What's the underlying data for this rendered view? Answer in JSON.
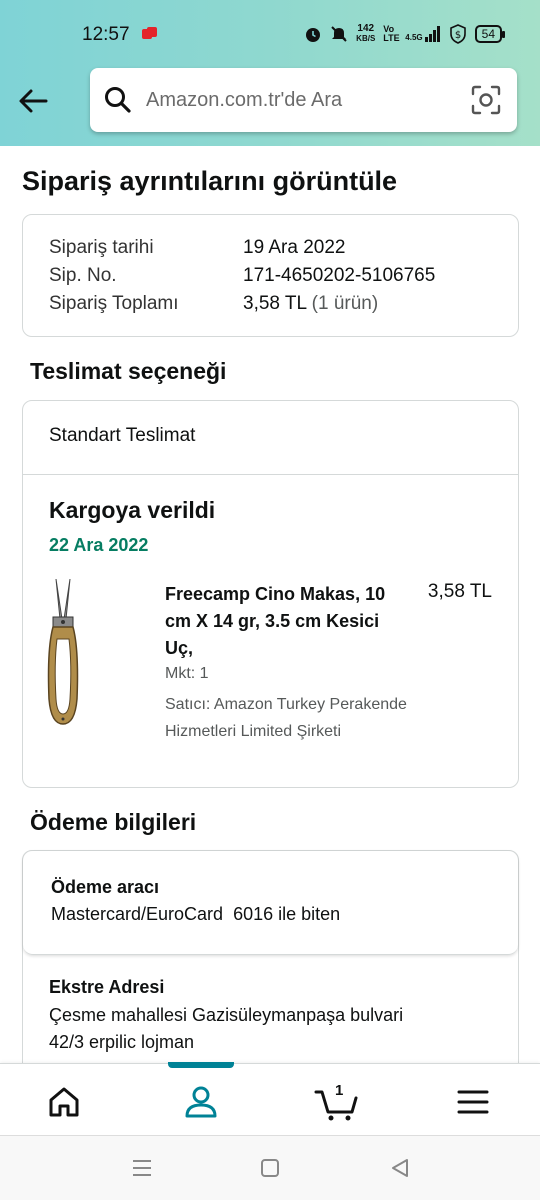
{
  "status_bar": {
    "time": "12:57",
    "net_speed_value": "142",
    "net_speed_unit": "KB/S",
    "volte": "Vo LTE",
    "signal": "4.5G",
    "battery": "54"
  },
  "search": {
    "placeholder": "Amazon.com.tr'de Ara"
  },
  "page": {
    "title": "Sipariş ayrıntılarını görüntüle"
  },
  "order_summary": {
    "rows": [
      {
        "label": "Sipariş tarihi",
        "value": "19 Ara 2022"
      },
      {
        "label": "Sip. No.",
        "value": "171-4650202-5106765"
      },
      {
        "label": "Sipariş Toplamı",
        "value": "3,58 TL",
        "extra": "(1 ürün)"
      }
    ]
  },
  "delivery": {
    "section_title": "Teslimat seçeneği",
    "type": "Standart Teslimat",
    "status": "Kargoya verildi",
    "date": "22 Ara 2022",
    "item": {
      "name": "Freecamp Cino Makas, 10 cm X 14 gr, 3.5 cm Kesici Uç,",
      "price": "3,58 TL",
      "quantity": "Mkt: 1",
      "seller": "Satıcı: Amazon Turkey Perakende Hizmetleri Limited Şirketi"
    }
  },
  "payment": {
    "section_title": "Ödeme bilgileri",
    "method_label": "Ödeme aracı",
    "method_value": "Mastercard/EuroCard  6016 ile biten",
    "address_label": "Ekstre Adresi",
    "address_line1": "Çesme mahallesi Gazisüleymanpaşa bulvari",
    "address_line2": "42/3 erpilic lojman"
  },
  "bottom_nav": {
    "items": [
      {
        "icon": "home-icon"
      },
      {
        "icon": "account-icon",
        "active": true
      },
      {
        "icon": "cart-icon",
        "count": "1"
      },
      {
        "icon": "menu-icon"
      }
    ]
  },
  "colors": {
    "header_gradient_start": "#7fd3d6",
    "header_gradient_end": "#a5e0c9",
    "green_date": "#067d62",
    "active_tab": "#008296"
  }
}
